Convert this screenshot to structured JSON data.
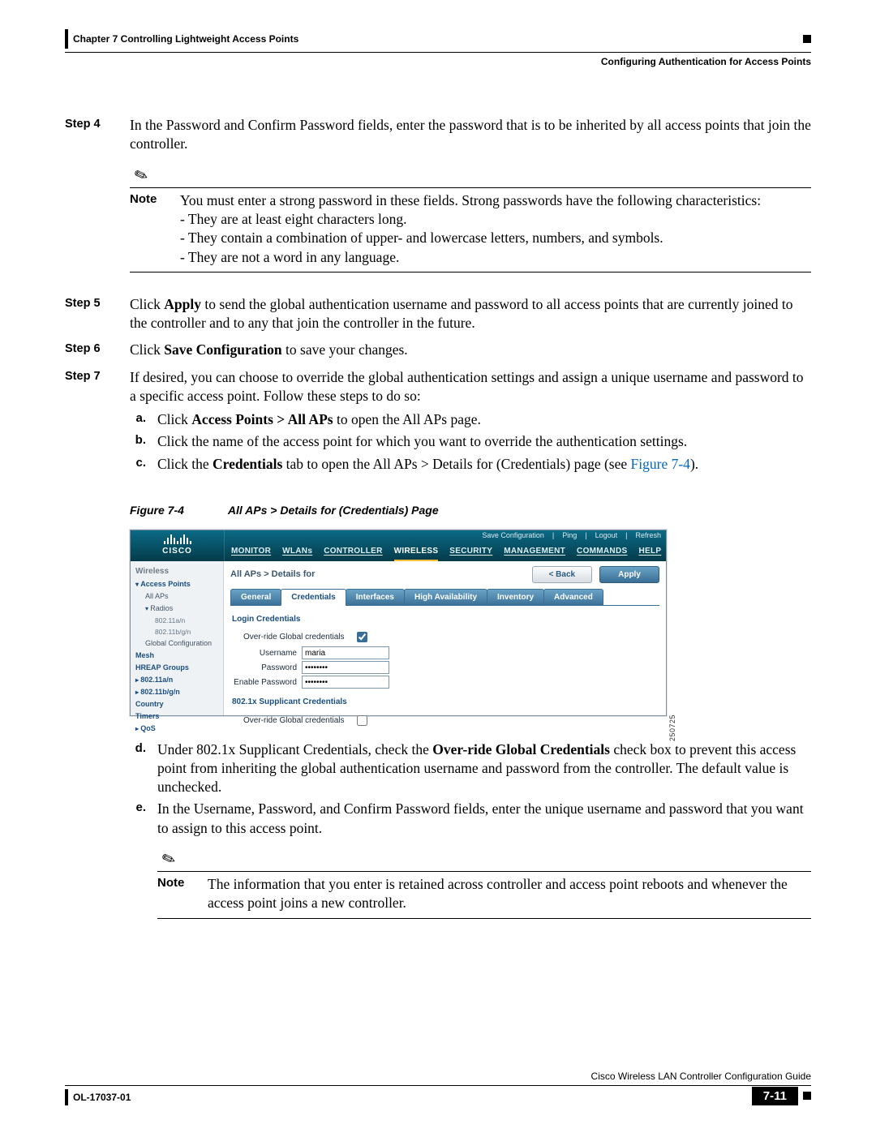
{
  "runhead": {
    "chapter": "Chapter 7      Controlling Lightweight Access Points",
    "section": "Configuring Authentication for Access Points"
  },
  "steps": {
    "s4": {
      "label": "Step 4",
      "para": "In the Password and Confirm Password fields, enter the password that is to be inherited by all access points that join the controller."
    },
    "note1": {
      "label": "Note",
      "lead": "You must enter a strong password in these fields. Strong passwords have the following characteristics:",
      "b1": "- They are at least eight characters long.",
      "b2": "- They contain a combination of upper- and lowercase letters, numbers, and symbols.",
      "b3": "- They are not a word in any language."
    },
    "s5": {
      "label": "Step 5",
      "pre": "Click ",
      "bold": "Apply",
      "post": " to send the global authentication username and password to all access points that are currently joined to the controller and to any that join the controller in the future."
    },
    "s6": {
      "label": "Step 6",
      "pre": "Click ",
      "bold": "Save Configuration",
      "post": " to save your changes."
    },
    "s7": {
      "label": "Step 7",
      "para": "If desired, you can choose to override the global authentication settings and assign a unique username and password to a specific access point. Follow these steps to do so:",
      "a": {
        "l": "a.",
        "pre": "Click ",
        "bold": "Access Points > All APs",
        "post": " to open the All APs page."
      },
      "b": {
        "l": "b.",
        "txt": "Click the name of the access point for which you want to override the authentication settings."
      },
      "c": {
        "l": "c.",
        "pre": "Click the ",
        "bold": "Credentials",
        "mid": " tab to open the All APs > Details for (Credentials) page (see ",
        "link": "Figure 7-4",
        "post": ")."
      }
    },
    "fig": {
      "num": "Figure 7-4",
      "title": "All APs > Details for (Credentials) Page"
    },
    "ui": {
      "brand": "CISCO",
      "util": {
        "save": "Save Configuration",
        "ping": "Ping",
        "logout": "Logout",
        "refresh": "Refresh"
      },
      "nav": {
        "monitor": "MONITOR",
        "wlans": "WLANs",
        "controller": "CONTROLLER",
        "wireless": "WIRELESS",
        "security": "SECURITY",
        "management": "MANAGEMENT",
        "commands": "COMMANDS",
        "help": "HELP"
      },
      "side": {
        "heading": "Wireless",
        "ap": "Access Points",
        "allaps": "All APs",
        "radios": "Radios",
        "r1": "802.11a/n",
        "r2": "802.11b/g/n",
        "gc": "Global Configuration",
        "mesh": "Mesh",
        "hreap": "HREAP Groups",
        "n1": "802.11a/n",
        "n2": "802.11b/g/n",
        "country": "Country",
        "timers": "Timers",
        "qos": "QoS"
      },
      "main": {
        "title": "All APs > Details for",
        "back": "< Back",
        "apply": "Apply",
        "tabs": {
          "general": "General",
          "credentials": "Credentials",
          "interfaces": "Interfaces",
          "ha": "High Availability",
          "inventory": "Inventory",
          "advanced": "Advanced"
        },
        "sec1": "Login Credentials",
        "f_override": "Over-ride Global credentials",
        "f_user": "Username",
        "v_user": "maria",
        "f_pass": "Password",
        "v_pass": "••••••••",
        "f_epass": "Enable Password",
        "v_epass": "••••••••",
        "sec2": "802.1x Supplicant Credentials",
        "f_override2": "Over-ride Global credentials"
      },
      "sideid": "250725"
    },
    "after": {
      "d": {
        "l": "d.",
        "pre": "Under 802.1x Supplicant Credentials, check the ",
        "bold": "Over-ride Global Credentials",
        "post": " check box to prevent this access point from inheriting the global authentication username and password from the controller. The default value is unchecked."
      },
      "e": {
        "l": "e.",
        "txt": "In the Username, Password, and Confirm Password fields, enter the unique username and password that you want to assign to this access point."
      }
    },
    "note2": {
      "label": "Note",
      "txt": "The information that you enter is retained across controller and access point reboots and whenever the access point joins a new controller."
    }
  },
  "footer": {
    "guide": "Cisco Wireless LAN Controller Configuration Guide",
    "doc": "OL-17037-01",
    "page": "7-11"
  }
}
